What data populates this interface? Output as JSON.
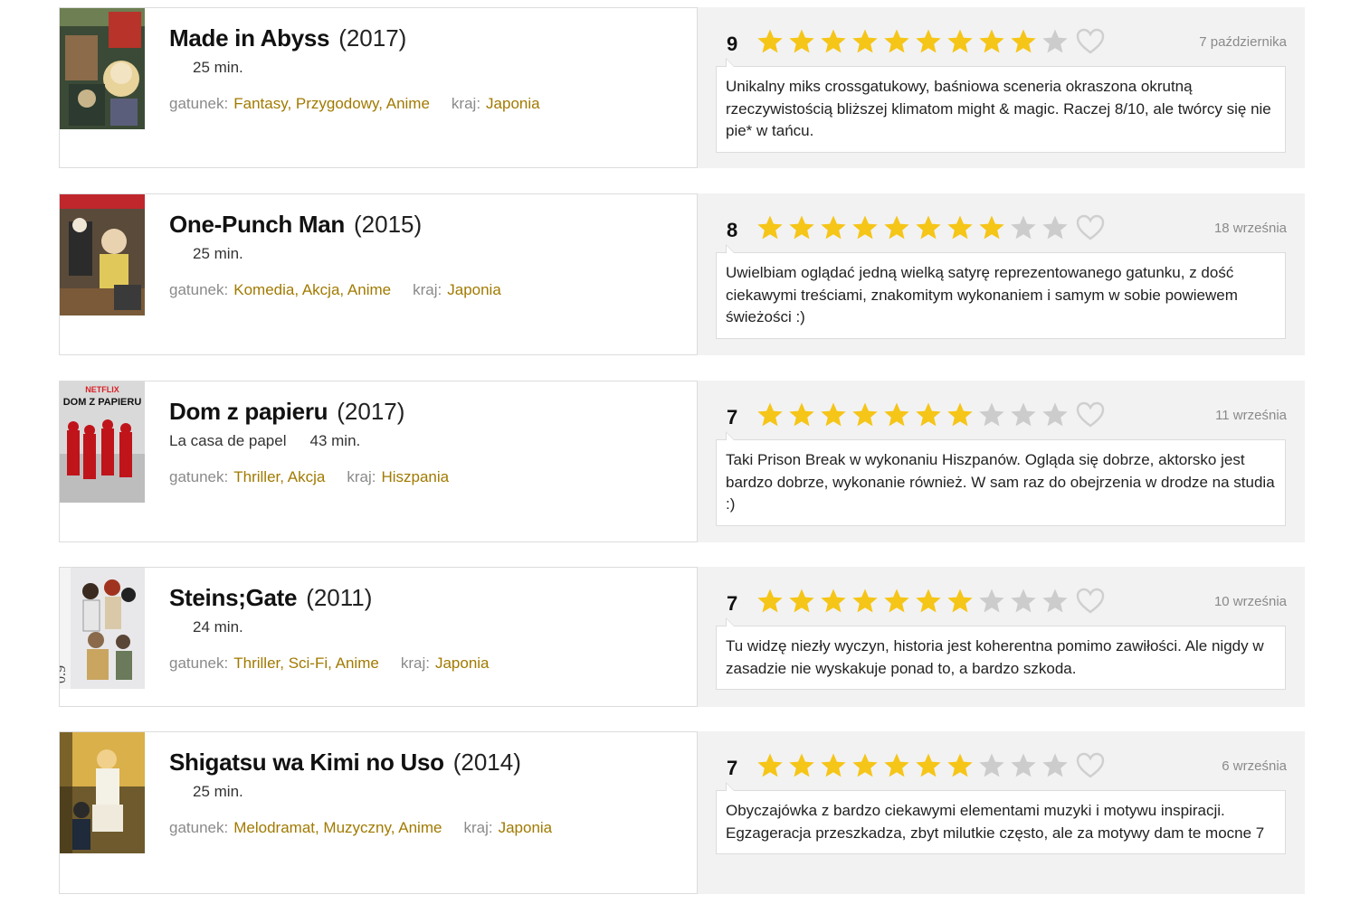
{
  "colors": {
    "star_on": "#f5c518",
    "star_off": "#cccccc",
    "link": "#a17a00"
  },
  "labels": {
    "genre": "gatunek:",
    "country": "kraj:"
  },
  "entries": [
    {
      "title": "Made in Abyss",
      "year": "(2017)",
      "original_title": "",
      "duration": "25 min.",
      "genres": "Fantasy, Przygodowy, Anime",
      "country": "Japonia",
      "rating": "9",
      "stars_filled": 9,
      "date": "7 października",
      "review": "Unikalny miks crossgatukowy, baśniowa sceneria okraszona okrutną rzeczywistością bliższej klimatom might & magic. Raczej 8/10, ale twórcy się nie pie* w tańcu.",
      "poster_icon": "made-in-abyss-poster"
    },
    {
      "title": "One-Punch Man",
      "year": "(2015)",
      "original_title": "",
      "duration": "25 min.",
      "genres": "Komedia, Akcja, Anime",
      "country": "Japonia",
      "rating": "8",
      "stars_filled": 8,
      "date": "18 września",
      "review": "Uwielbiam oglądać jedną wielką satyrę reprezentowanego gatunku, z dość ciekawymi treściami, znakomitym wykonaniem i samym w sobie powiewem świeżości :)",
      "poster_icon": "one-punch-man-poster"
    },
    {
      "title": "Dom z papieru",
      "year": "(2017)",
      "original_title": "La casa de papel",
      "duration": "43 min.",
      "genres": "Thriller, Akcja",
      "country": "Hiszpania",
      "rating": "7",
      "stars_filled": 7,
      "date": "11 września",
      "review": "Taki Prison Break w wykonaniu Hiszpanów. Ogląda się dobrze, aktorsko jest bardzo dobrze, wykonanie również. W sam raz do obejrzenia w drodze na studia :)",
      "poster_icon": "dom-z-papieru-poster",
      "poster_text": {
        "netflix": "NETFLIX",
        "title": "DOM Z PAPIERU"
      }
    },
    {
      "title": "Steins;Gate",
      "year": "(2011)",
      "original_title": "",
      "duration": "24 min.",
      "genres": "Thriller, Sci-Fi, Anime",
      "country": "Japonia",
      "rating": "7",
      "stars_filled": 7,
      "date": "10 września",
      "review": "Tu widzę niezły wyczyn, historia jest koherentna pomimo zawiłości. Ale nigdy w zasadzie nie wyskakuje ponad to, a bardzo szkoda.",
      "poster_icon": "steins-gate-poster"
    },
    {
      "title": "Shigatsu wa Kimi no Uso",
      "year": "(2014)",
      "original_title": "",
      "duration": "25 min.",
      "genres": "Melodramat, Muzyczny, Anime",
      "country": "Japonia",
      "rating": "7",
      "stars_filled": 7,
      "date": "6 września",
      "review": "Obyczajówka z bardzo ciekawymi elementami muzyki i motywu inspiracji. Egzageracja przeszkadza, zbyt milutkie często, ale za motywy dam te mocne 7",
      "poster_icon": "shigatsu-poster"
    }
  ]
}
